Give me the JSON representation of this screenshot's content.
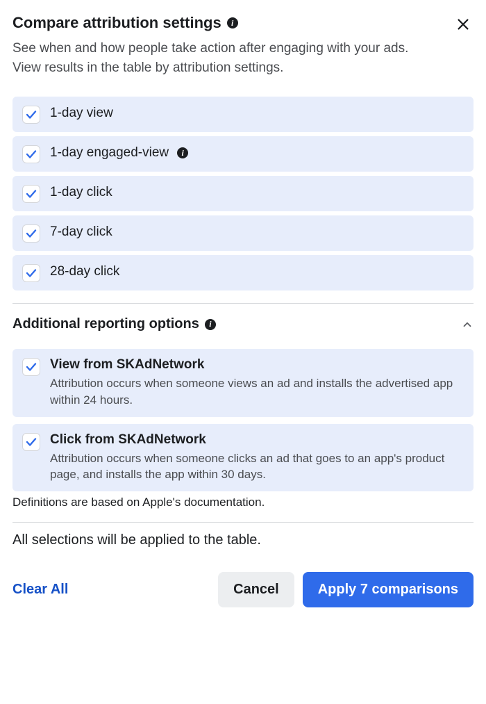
{
  "header": {
    "title": "Compare attribution settings",
    "subtitle": "See when and how people take action after engaging with your ads. View results in the table by attribution settings."
  },
  "options": [
    {
      "label": "1-day view",
      "has_info": false
    },
    {
      "label": "1-day engaged-view",
      "has_info": true
    },
    {
      "label": "1-day click",
      "has_info": false
    },
    {
      "label": "7-day click",
      "has_info": false
    },
    {
      "label": "28-day click",
      "has_info": false
    }
  ],
  "additional": {
    "title": "Additional reporting options",
    "items": [
      {
        "title": "View from SKAdNetwork",
        "desc": "Attribution occurs when someone views an ad and installs the advertised app within 24 hours."
      },
      {
        "title": "Click from SKAdNetwork",
        "desc": "Attribution occurs when someone clicks an ad that goes to an app's product page, and installs the app within 30 days."
      }
    ],
    "note": "Definitions are based on Apple's documentation."
  },
  "summary": "All selections will be applied to the table.",
  "footer": {
    "clear": "Clear All",
    "cancel": "Cancel",
    "apply": "Apply 7 comparisons"
  }
}
